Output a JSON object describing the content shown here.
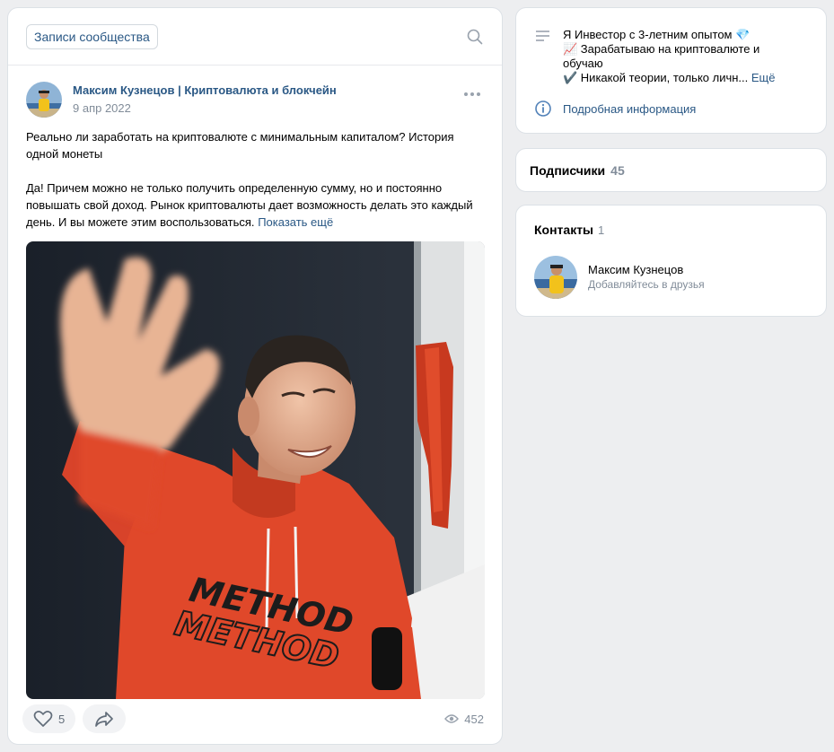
{
  "feed": {
    "tab_label": "Записи сообщества",
    "post": {
      "author": "Максим Кузнецов | Криптовалюта и блокчейн",
      "date": "9 апр 2022",
      "paragraph1": "Реально ли заработать на криптовалюте с минимальным капиталом? История одной монеты",
      "paragraph2": "Да! Причем можно не только получить определенную сумму, но и постоянно повышать свой доход. Рынок криптовалюты дает возможность делать это каждый день. И вы можете этим воспользоваться.",
      "show_more": "Показать ещё",
      "photo_text": "METHOD",
      "likes": "5",
      "views": "452"
    }
  },
  "about": {
    "line1": "Я Инвестор с 3-летним опытом 💎",
    "line2": "📈 Зарабатываю на криптовалюте и",
    "line3": "обучаю",
    "line4": "✔️ Никакой теории, только личн...",
    "more": "Ещё",
    "details_link": "Подробная информация"
  },
  "subscribers": {
    "title": "Подписчики",
    "count": "45"
  },
  "contacts": {
    "title": "Контакты",
    "count": "1",
    "items": [
      {
        "name": "Максим Кузнецов",
        "subtitle": "Добавляйтесь в друзья"
      }
    ]
  },
  "colors": {
    "background": "#edeef0",
    "link": "#2a5885",
    "muted": "#818c99",
    "hoodie": "#e0482a"
  }
}
